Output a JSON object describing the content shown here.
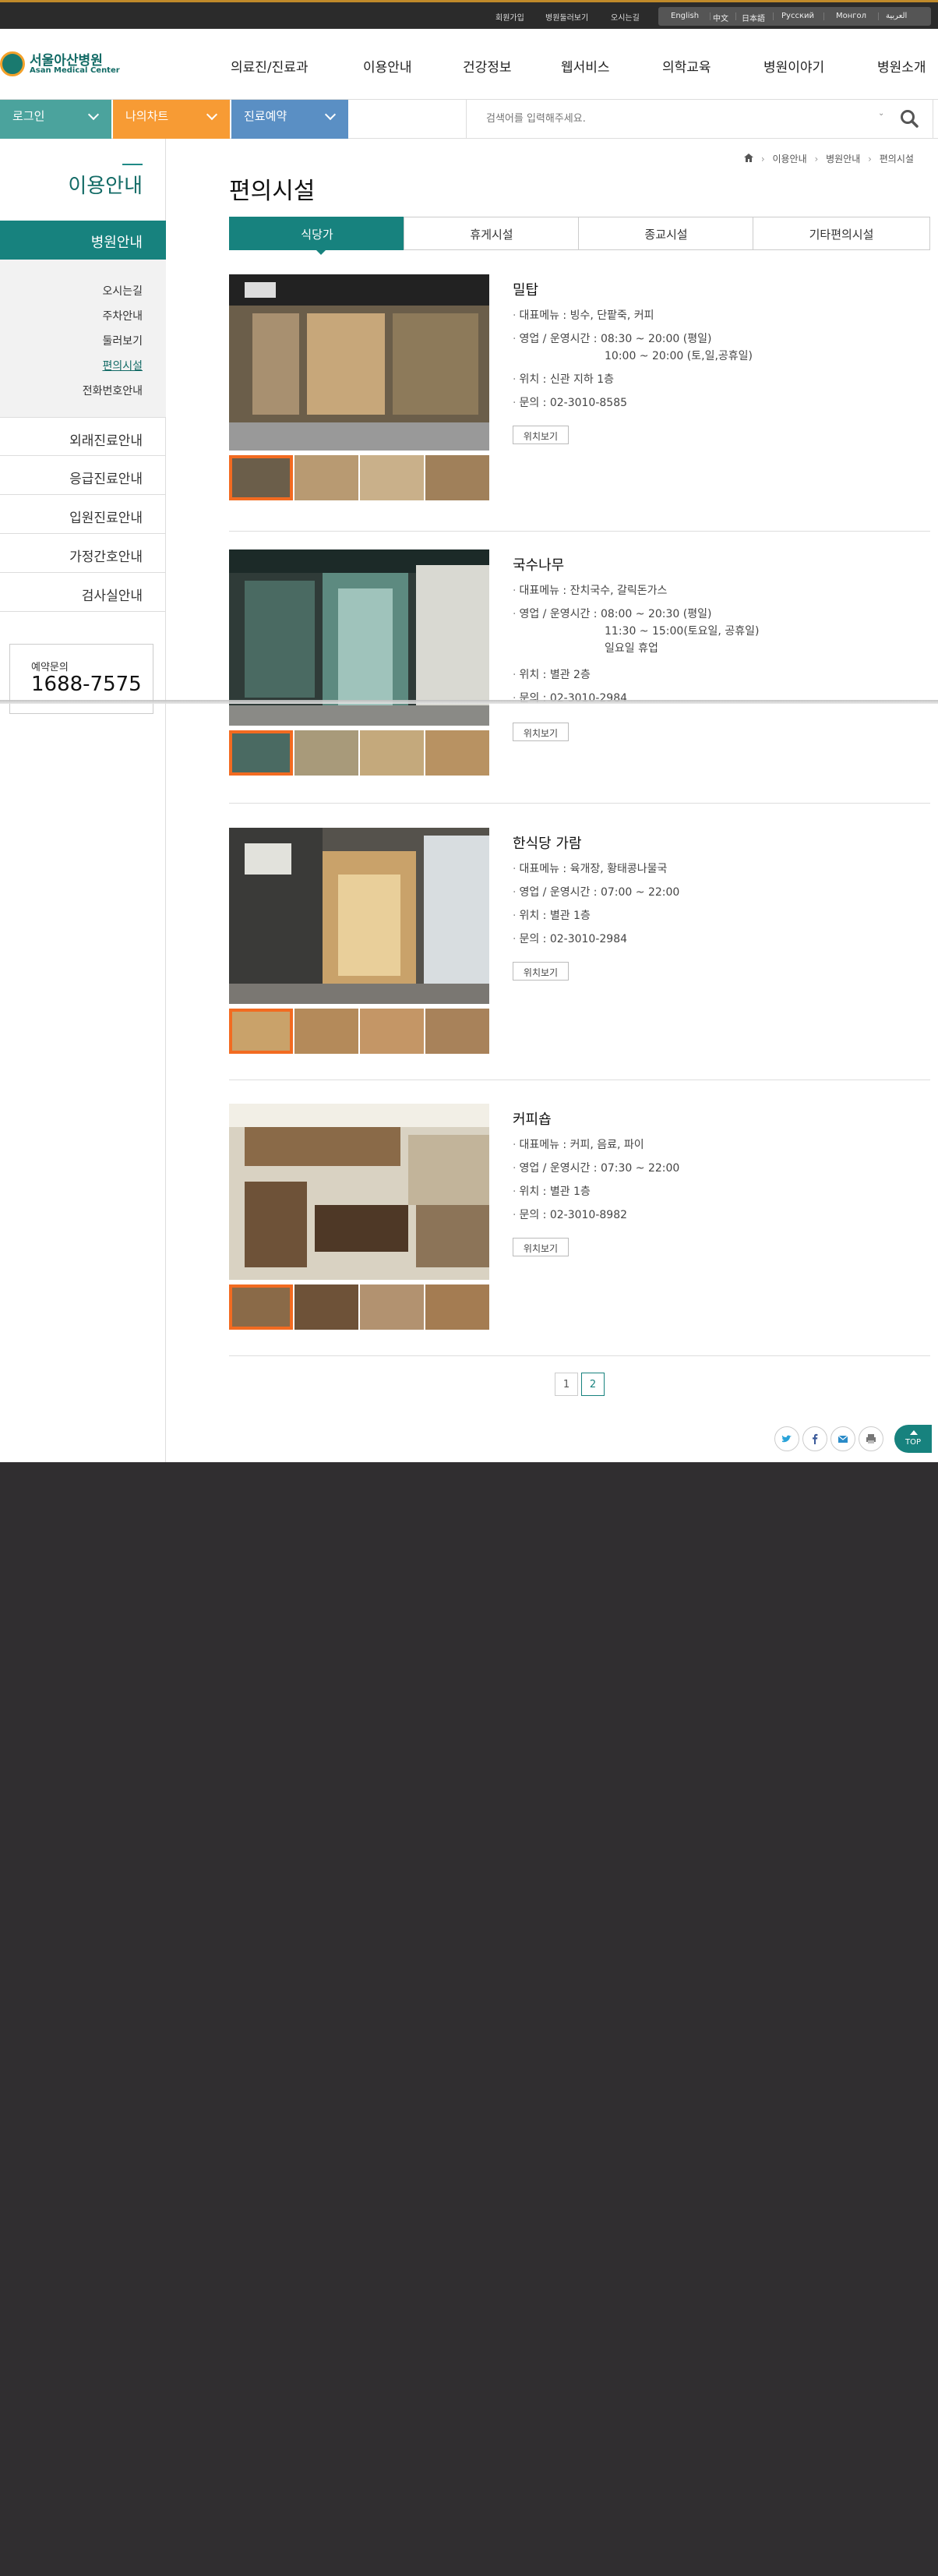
{
  "top_bar": {
    "utility_links": [
      "회원가입",
      "병원둘러보기",
      "오시는길"
    ],
    "languages": [
      "English",
      "中文",
      "日本語",
      "Русский",
      "Монгол",
      "العربية"
    ]
  },
  "logo": {
    "korean": "서울아산병원",
    "english": "Asan Medical Center"
  },
  "gnb": [
    "의료진/진료과",
    "이용안내",
    "건강정보",
    "웹서비스",
    "의학교육",
    "병원이야기",
    "병원소개"
  ],
  "quick_bar": {
    "login": "로그인",
    "my_chart": "나의차트",
    "reservation": "진료예약",
    "search_placeholder": "검색어를 입력해주세요."
  },
  "colors": {
    "teal": "#17827e",
    "orange": "#f79b34",
    "blue": "#5a8fc4",
    "login_teal": "#4ba39d",
    "highlight": "#f26b21"
  },
  "sidebar": {
    "title": "이용안내",
    "active": "병원안내",
    "sub_items": [
      "오시는길",
      "주차안내",
      "둘러보기",
      "편의시설",
      "전화번호안내"
    ],
    "current_sub": "편의시설",
    "items": [
      "외래진료안내",
      "응급진료안내",
      "입원진료안내",
      "가정간호안내",
      "검사실안내"
    ],
    "contact_label": "예약문의",
    "contact_number": "1688-7575"
  },
  "breadcrumb": {
    "home_icon": "home-icon",
    "items": [
      "이용안내",
      "병원안내",
      "편의시설"
    ]
  },
  "page_title": "편의시설",
  "tabs": [
    "식당가",
    "휴게시설",
    "종교시설",
    "기타편의시설"
  ],
  "active_tab": "식당가",
  "facilities": [
    {
      "name": "밀탑",
      "lines": [
        "대표메뉴 : 빙수, 단팥죽, 커피",
        "영업 / 운영시간 : 08:30 ~ 20:00 (평일)",
        "10:00 ~ 20:00 (토,일,공휴일)",
        "위치 : 신관 지하 1층",
        "문의 : 02-3010-8585"
      ],
      "button": "위치보기"
    },
    {
      "name": "국수나무",
      "lines": [
        "대표메뉴 : 잔치국수, 갈릭돈가스",
        "영업 / 운영시간 : 08:00 ~ 20:30 (평일)",
        "11:30 ~ 15:00(토요일, 공휴일)",
        "일요일 휴업",
        "위치 : 별관 2층",
        "문의 : 02-3010-2984"
      ],
      "button": "위치보기"
    },
    {
      "name": "한식당 가람",
      "lines": [
        "대표메뉴 : 육개장, 황태콩나물국",
        "영업 / 운영시간 : 07:00 ~ 22:00",
        "위치 : 별관 1층",
        "문의 : 02-3010-2984"
      ],
      "button": "위치보기"
    },
    {
      "name": "커피숍",
      "lines": [
        "대표메뉴 : 커피, 음료, 파이",
        "영업 / 운영시간 : 07:30 ~ 22:00",
        "위치 : 별관 1층",
        "문의 : 02-3010-8982"
      ],
      "button": "위치보기"
    }
  ],
  "pagination": {
    "pages": [
      "1",
      "2"
    ],
    "current": "2"
  },
  "share_icons": [
    "twitter-icon",
    "facebook-icon",
    "email-icon",
    "print-icon"
  ],
  "top_button": "TOP"
}
